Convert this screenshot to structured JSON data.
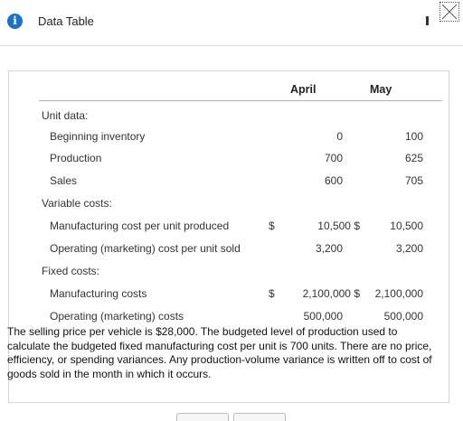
{
  "window": {
    "title": "Data Table",
    "info_icon": "info-icon",
    "minimize_icon": "minimize-icon",
    "close_icon": "close-icon"
  },
  "table": {
    "columns": [
      "April",
      "May"
    ],
    "sections": {
      "unit_data": "Unit data:",
      "variable_costs": "Variable costs:",
      "fixed_costs": "Fixed costs:"
    },
    "rows": [
      {
        "label": "Beginning inventory",
        "april": "0",
        "may": "100"
      },
      {
        "label": "Production",
        "april": "700",
        "may": "625"
      },
      {
        "label": "Sales",
        "april": "600",
        "may": "705"
      },
      {
        "label": "Manufacturing cost per unit produced",
        "dollar": "$",
        "april": "10,500 $",
        "may": "10,500"
      },
      {
        "label": "Operating (marketing) cost per unit sold",
        "april": "3,200",
        "may": "3,200"
      },
      {
        "label": "Manufacturing costs",
        "dollar": "$",
        "april": "2,100,000 $",
        "may": "2,100,000"
      },
      {
        "label": "Operating (marketing) costs",
        "april": "500,000",
        "may": "500,000"
      }
    ]
  },
  "note": "The selling price per vehicle is $28,000. The budgeted level of production used to calculate the budgeted fixed manufacturing cost per unit is 700 units. There are no price, efficiency, or spending variances. Any production-volume variance is written off to cost of goods sold in the month in which it occurs.",
  "colors": {
    "accent": "#1a73c9",
    "border": "#d6d6d6"
  }
}
